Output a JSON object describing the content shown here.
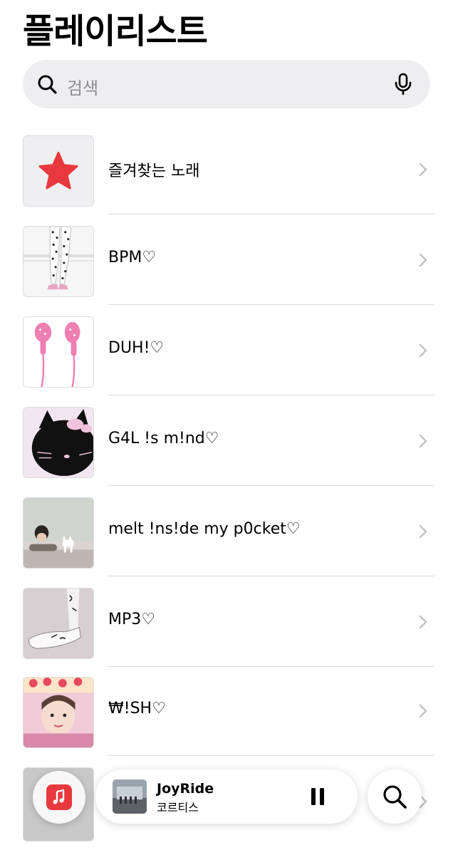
{
  "header": {
    "title": "플레이리스트"
  },
  "search": {
    "placeholder": "검색",
    "icon": "magnifier-icon",
    "voice_icon": "microphone-icon"
  },
  "playlists": [
    {
      "label": "즐겨찾는 노래",
      "art": "favorites-star-icon"
    },
    {
      "label": "BPM♡",
      "art": "polka-dot-legs-image"
    },
    {
      "label": "DUH!♡",
      "art": "pink-earphones-image"
    },
    {
      "label": "G4L !s m!nd♡",
      "art": "black-kitty-image"
    },
    {
      "label": "melt !ns!de my p0cket♡",
      "art": "girl-with-cat-image"
    },
    {
      "label": "MP3♡",
      "art": "shoes-image"
    },
    {
      "label": "₩!SH♡",
      "art": "cake-face-image"
    }
  ],
  "mini_player": {
    "song": "JoyRide",
    "artist": "코르티스",
    "app_icon": "music-app-icon",
    "pause_icon": "pause-icon",
    "search_icon": "search-icon"
  },
  "colors": {
    "accent": "#e8393f",
    "divider": "#d9d9dc",
    "search_bg": "#eeeef0",
    "chevron": "#c4c4c7"
  }
}
